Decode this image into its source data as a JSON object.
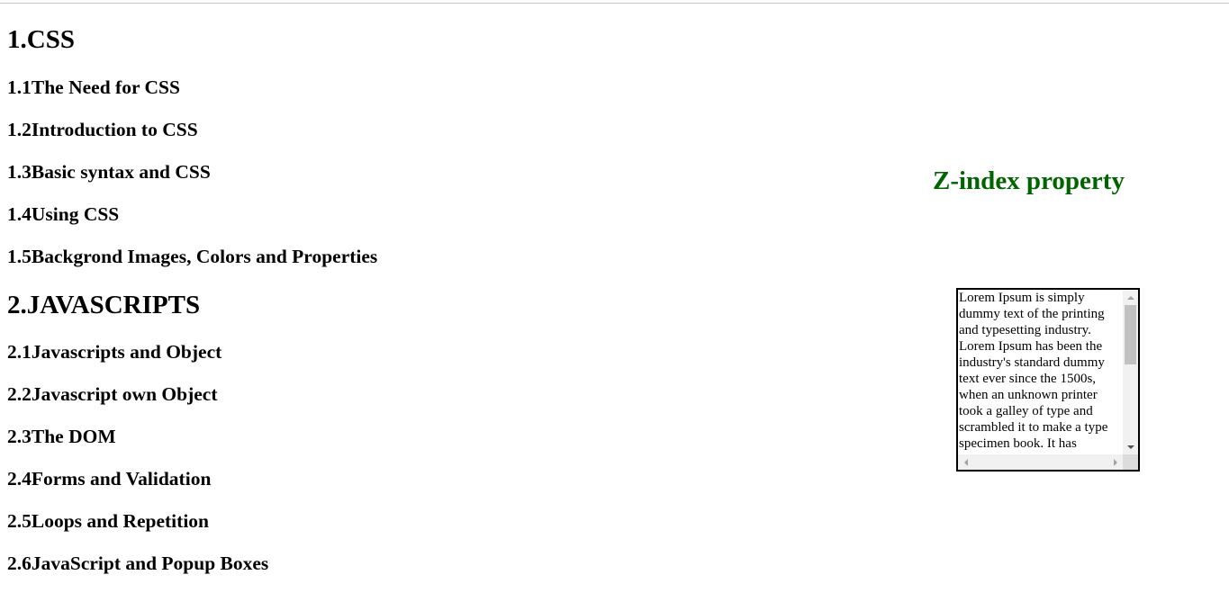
{
  "sections": [
    {
      "title": "1.CSS",
      "items": [
        "1.1The Need for CSS",
        "1.2Introduction to CSS",
        "1.3Basic syntax and CSS",
        "1.4Using CSS",
        "1.5Backgrond Images, Colors and Properties"
      ]
    },
    {
      "title": "2.JAVASCRIPTS",
      "items": [
        "2.1Javascripts and Object",
        "2.2Javascript own Object",
        "2.3The DOM",
        "2.4Forms and Validation",
        "2.5Loops and Repetition",
        "2.6JavaScript and Popup Boxes"
      ]
    }
  ],
  "side_title": "Z-index property",
  "side_title_color": "#006400",
  "scroll_box_text": "Lorem Ipsum is simply dummy text of the printing and typesetting industry. Lorem Ipsum has been the industry's standard dummy text ever since the 1500s, when an unknown printer took a galley of type and scrambled it to make a type specimen book. It has",
  "icons": {
    "scroll_up": "arrow-up-icon",
    "scroll_down": "arrow-down-icon",
    "scroll_left": "arrow-left-icon",
    "scroll_right": "arrow-right-icon"
  }
}
